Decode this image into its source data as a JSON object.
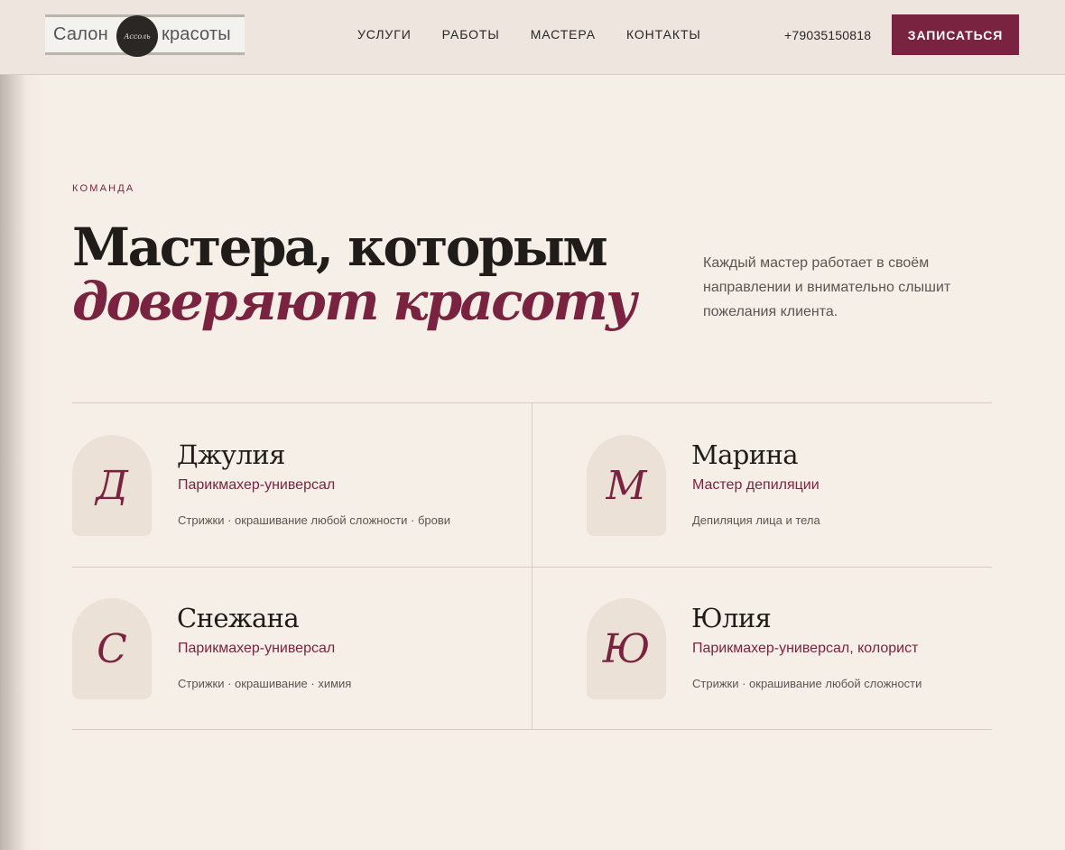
{
  "header": {
    "logo": {
      "left_word": "Салон",
      "script_word": "Ассоль",
      "right_word": "красоты"
    },
    "nav": [
      {
        "label": "Услуги"
      },
      {
        "label": "Работы"
      },
      {
        "label": "Мастера"
      },
      {
        "label": "Контакты"
      }
    ],
    "phone": "+79035150818",
    "cta_label": "Записаться"
  },
  "section": {
    "eyebrow": "Команда",
    "title_line1": "Мастера, которым",
    "title_line2": "доверяют красоту",
    "intro": "Каждый мастер работает в своём направлении и внимательно слышит пожелания клиента."
  },
  "masters": [
    {
      "initial": "Д",
      "name": "Джулия",
      "role": "Парикмахер-универсал",
      "skills": "Стрижки · окрашивание любой сложности · брови"
    },
    {
      "initial": "М",
      "name": "Марина",
      "role": "Мастер депиляции",
      "skills": "Депиляция лица и тела"
    },
    {
      "initial": "С",
      "name": "Снежана",
      "role": "Парикмахер-универсал",
      "skills": "Стрижки · окрашивание · химия"
    },
    {
      "initial": "Ю",
      "name": "Юлия",
      "role": "Парикмахер-универсал, колорист",
      "skills": "Стрижки · окрашивание любой сложности"
    }
  ],
  "colors": {
    "accent": "#7a2340",
    "background": "#f6efe8",
    "header": "#ede5de",
    "avatar": "#ece1d6"
  }
}
